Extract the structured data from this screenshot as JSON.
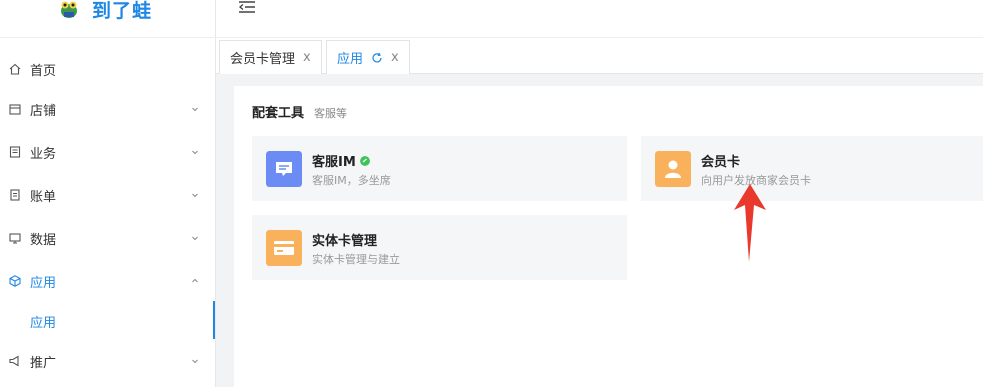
{
  "brand": {
    "name": "到了蛙"
  },
  "sidebar": {
    "items": [
      {
        "label": "首页",
        "icon": "home-icon",
        "has_chevron": false
      },
      {
        "label": "店铺",
        "icon": "store-icon",
        "has_chevron": true
      },
      {
        "label": "业务",
        "icon": "business-icon",
        "has_chevron": true
      },
      {
        "label": "账单",
        "icon": "bill-icon",
        "has_chevron": true
      },
      {
        "label": "数据",
        "icon": "data-icon",
        "has_chevron": true
      },
      {
        "label": "应用",
        "icon": "app-icon",
        "has_chevron": true,
        "expanded": true,
        "active": true
      },
      {
        "label": "应用",
        "icon": null,
        "sub": true,
        "selected": true
      },
      {
        "label": "推广",
        "icon": "promote-icon",
        "has_chevron": true
      }
    ]
  },
  "tabs": [
    {
      "label": "会员卡管理",
      "active": false
    },
    {
      "label": "应用",
      "active": true
    }
  ],
  "section": {
    "title": "配套工具",
    "subtitle": "客服等"
  },
  "cards": [
    {
      "title": "客服IM",
      "desc": "客服IM，多坐席",
      "icon": "chat-icon",
      "icon_color": "#6b8cf5",
      "badge": true
    },
    {
      "title": "会员卡",
      "desc": "向用户发放商家会员卡",
      "icon": "member-card-icon",
      "icon_color": "#f9b25b",
      "badge": false
    },
    {
      "title": "实体卡管理",
      "desc": "实体卡管理与建立",
      "icon": "physical-card-icon",
      "icon_color": "#f9b25b",
      "badge": false
    }
  ],
  "colors": {
    "accent": "#1e87e6",
    "annotation_arrow": "#e8392c",
    "badge": "#3cc35a"
  }
}
